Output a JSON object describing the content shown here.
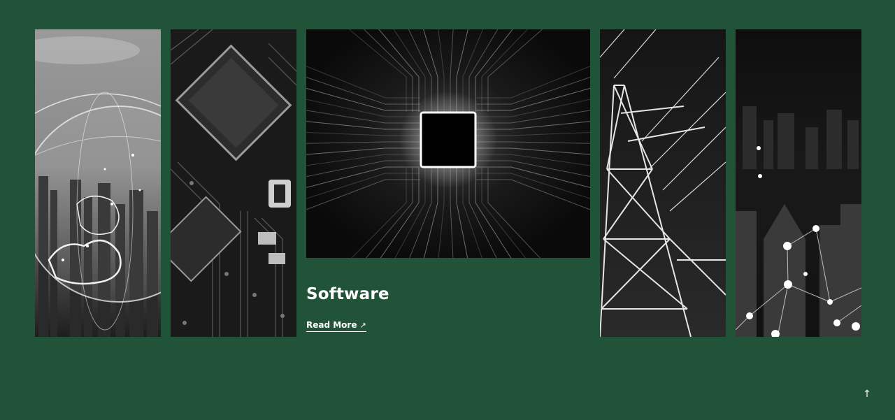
{
  "panels": [
    {
      "icon": "globe-city-image"
    },
    {
      "icon": "circuit-board-image"
    },
    {
      "icon": "cpu-chip-image"
    },
    {
      "icon": "power-tower-image"
    },
    {
      "icon": "city-network-image"
    }
  ],
  "feature": {
    "title": "Software",
    "read_more_label": "Read More",
    "read_more_icon": "↗"
  },
  "scroll_top": {
    "icon": "↑"
  },
  "colors": {
    "background": "#215339",
    "text": "#ffffff"
  }
}
